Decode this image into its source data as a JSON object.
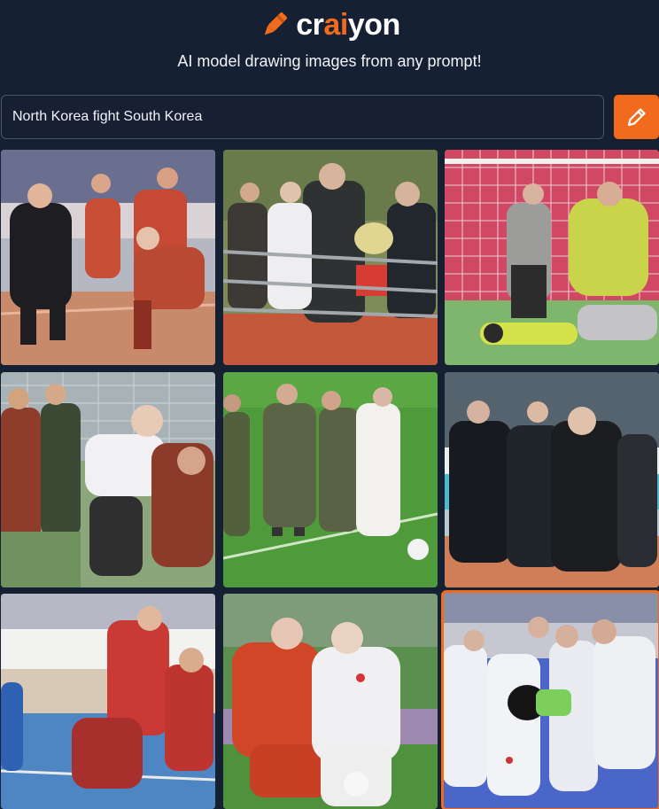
{
  "brand": {
    "prefix": "cr",
    "accent": "ai",
    "suffix": "yon",
    "accent_color": "#f26b1d",
    "logo_icon": "crayon-icon"
  },
  "tagline": "AI model drawing images from any prompt!",
  "search": {
    "value": "North Korea fight South Korea",
    "draw_icon": "pencil-icon"
  },
  "results": [
    {
      "name": "image-1",
      "scene": "indoor-court"
    },
    {
      "name": "image-2",
      "scene": "stadium-stands"
    },
    {
      "name": "image-3",
      "scene": "goal-net"
    },
    {
      "name": "image-4",
      "scene": "goal-net-crowd"
    },
    {
      "name": "image-5",
      "scene": "grass-field"
    },
    {
      "name": "image-6",
      "scene": "stadium-suits"
    },
    {
      "name": "image-7",
      "scene": "futsal-court"
    },
    {
      "name": "image-8",
      "scene": "soccer-duel"
    },
    {
      "name": "image-9",
      "scene": "blue-floor-crowd",
      "selected": true
    }
  ]
}
